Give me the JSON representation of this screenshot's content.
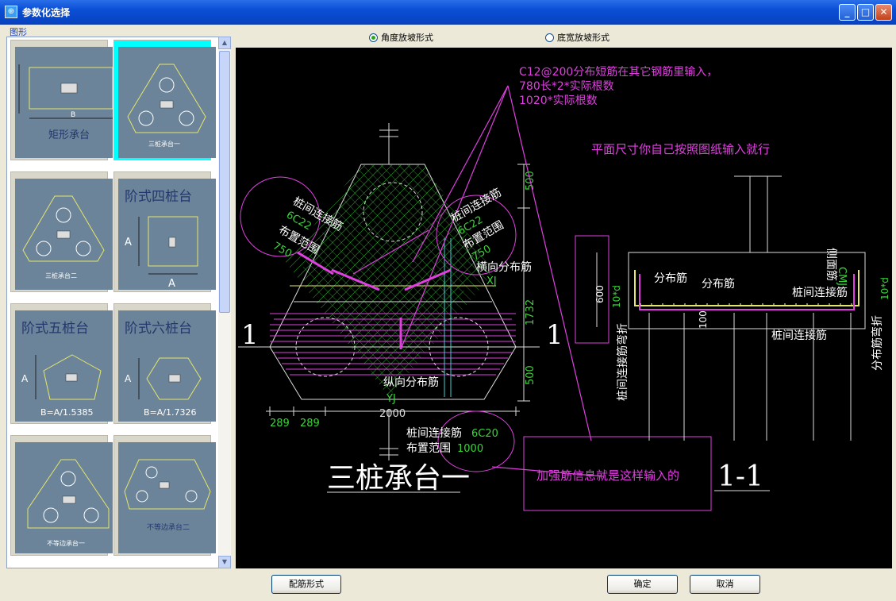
{
  "window": {
    "title": "参数化选择",
    "app_icon": "app-icon",
    "controls": [
      "minimize-icon",
      "maximize-icon",
      "close-icon"
    ]
  },
  "left": {
    "group_label": "图形",
    "thumbs": [
      {
        "label": "矩形承台",
        "b": "B"
      },
      {
        "label": "三桩承台一"
      },
      {
        "label": "三桩承台二"
      },
      {
        "label": "阶式四桩台",
        "a": "A"
      },
      {
        "label": "阶式五桩台",
        "a": "A",
        "b": "B=A/1.5385"
      },
      {
        "label": "阶式六桩台",
        "a": "A",
        "b": "B=A/1.7326"
      },
      {
        "label": "不等边承台一"
      },
      {
        "label": "不等边承台二"
      }
    ]
  },
  "options": {
    "angle": "角度放坡形式",
    "width": "底宽放坡形式",
    "selected": "angle"
  },
  "drawing": {
    "note1": "C12@200分布短筋在其它钢筋里输入，",
    "note2": "780长*2*实际根数",
    "note3": "1020*实际根数",
    "note4": "平面尺寸你自己按照图纸输入就行",
    "left_tie1": "桩间连接筋",
    "left_tie2": "6C22",
    "left_range": "布置范围",
    "left_val": "750",
    "right_tie1": "桩间连接筋",
    "right_tie2": "6C22",
    "right_range": "布置范围",
    "right_val": "750",
    "h_dist": "横向分布筋",
    "xj": "XJ",
    "v_dist": "纵向分布筋",
    "yj": "YJ",
    "sec1": "1",
    "sec2": "1",
    "dim_500a": "500",
    "dim_1732": "1732",
    "dim_500b": "500",
    "dim_289a": "289",
    "dim_289b": "289",
    "dim_2000": "2000",
    "bottom_tie": "桩间连接筋",
    "bottom_tie_v": "6C20",
    "bottom_range": "布置范围",
    "bottom_range_v": "1000",
    "big_title": "三桩承台一",
    "callout": "加强筋信息就是这样输入的",
    "sec_title": "1-1",
    "s_dist1": "分布筋",
    "s_dist2": "分布筋",
    "s_tie1": "桩间连接筋",
    "s_tie2": "桩间连接筋",
    "s_side": "侧面筋",
    "s_cm": "CMJ",
    "s_10d_l": "10*d",
    "s_10d_r": "10*d",
    "s_600": "600",
    "s_100": "100",
    "s_tie_bend": "桩间连接筋弯折",
    "s_dist_bend": "分布筋弯折"
  },
  "buttons": {
    "rebar": "配筋形式",
    "ok": "确定",
    "cancel": "取消"
  }
}
